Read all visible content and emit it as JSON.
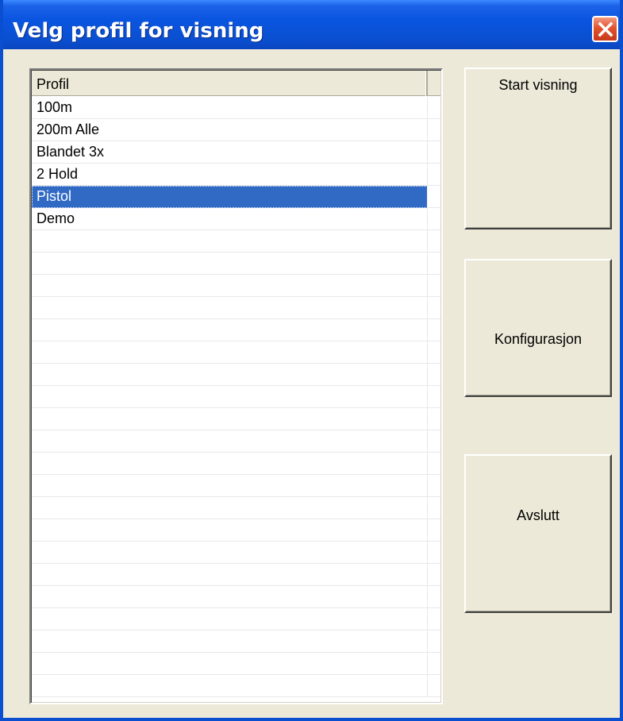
{
  "window": {
    "title": "Velg profil for visning",
    "close_icon": "close-icon",
    "title_color": "#0a4fd0",
    "face_color": "#ece9d8"
  },
  "listview": {
    "column_header": "Profil",
    "items": [
      {
        "label": "100m",
        "selected": false
      },
      {
        "label": "200m Alle",
        "selected": false
      },
      {
        "label": "Blandet 3x",
        "selected": false
      },
      {
        "label": "2 Hold",
        "selected": false
      },
      {
        "label": "Pistol",
        "selected": true
      },
      {
        "label": "Demo",
        "selected": false
      }
    ],
    "selection_color": "#316ac5"
  },
  "buttons": {
    "start_label": "Start visning",
    "config_label": "Konfigurasjon",
    "exit_label": "Avslutt"
  }
}
